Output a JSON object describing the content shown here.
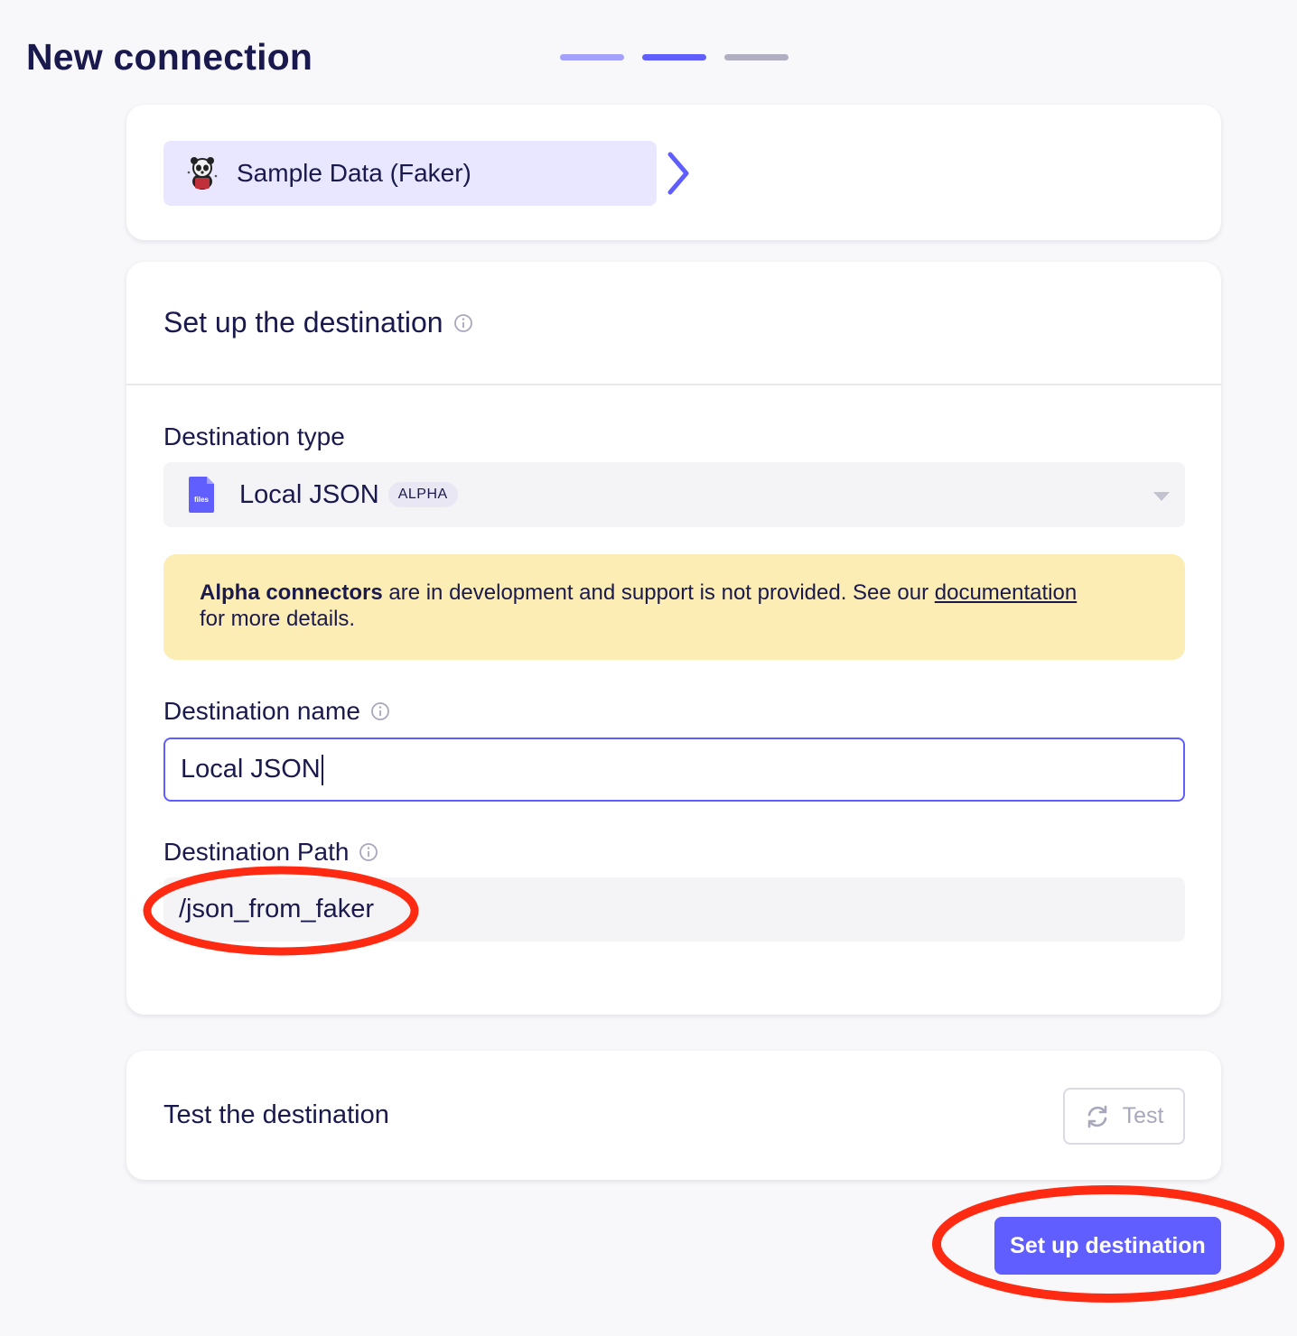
{
  "page": {
    "title": "New connection"
  },
  "stepper": {
    "steps": [
      "done",
      "current",
      "todo"
    ]
  },
  "source": {
    "name": "Sample Data (Faker)",
    "icon": "faker-logo-icon"
  },
  "destination_setup": {
    "title": "Set up the destination",
    "type_label": "Destination type",
    "type_value": "Local JSON",
    "type_badge": "ALPHA",
    "type_icon": "files-icon",
    "warning": {
      "bold": "Alpha connectors",
      "text": " are in development and support is not provided. See our ",
      "link": "documentation",
      "tail": "for more details."
    },
    "name_label": "Destination name",
    "name_value": "Local JSON",
    "path_label": "Destination Path",
    "path_value": "/json_from_faker"
  },
  "test": {
    "title": "Test the destination",
    "button_label": "Test"
  },
  "submit": {
    "label": "Set up destination"
  },
  "colors": {
    "accent": "#615eff",
    "warning_bg": "#fcedb5",
    "annotation": "#ff2a12",
    "text": "#1a194d"
  }
}
